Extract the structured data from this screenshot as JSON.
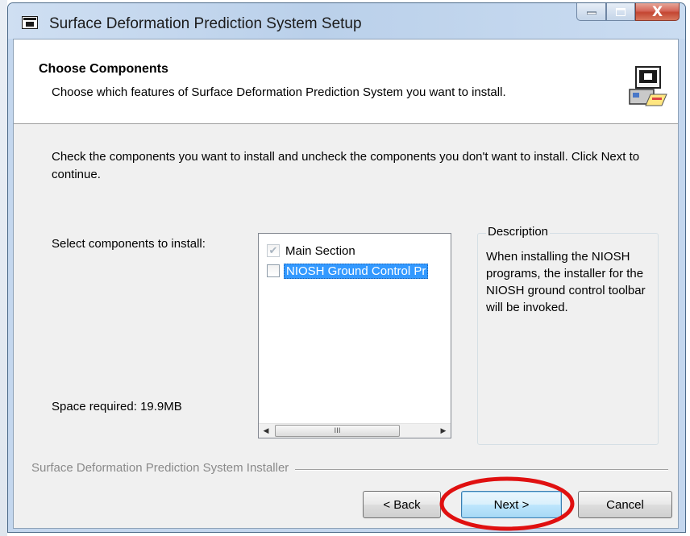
{
  "window": {
    "title": "Surface Deformation Prediction System Setup",
    "close_glyph": "X"
  },
  "header": {
    "title": "Choose Components",
    "subtitle": "Choose which features of Surface Deformation Prediction System you want to install."
  },
  "body": {
    "intro": "Check the components you want to install and uncheck the components you don't want to install. Click Next to continue.",
    "select_label": "Select components to install:",
    "space_required": "Space required: 19.9MB"
  },
  "components": [
    {
      "label": "Main Section",
      "checked": true,
      "disabled": true,
      "selected": false
    },
    {
      "label": "NIOSH Ground Control Pr",
      "checked": false,
      "disabled": false,
      "selected": true
    }
  ],
  "description": {
    "legend": "Description",
    "text": "When installing the NIOSH programs, the installer for the NIOSH ground control toolbar will be invoked."
  },
  "branding": "Surface Deformation Prediction System Installer",
  "buttons": {
    "back": "< Back",
    "next": "Next >",
    "cancel": "Cancel"
  },
  "scrollbar": {
    "thumb_glyph": "III"
  },
  "colors": {
    "highlight_ellipse": "#e01010",
    "selection": "#3399ff"
  }
}
